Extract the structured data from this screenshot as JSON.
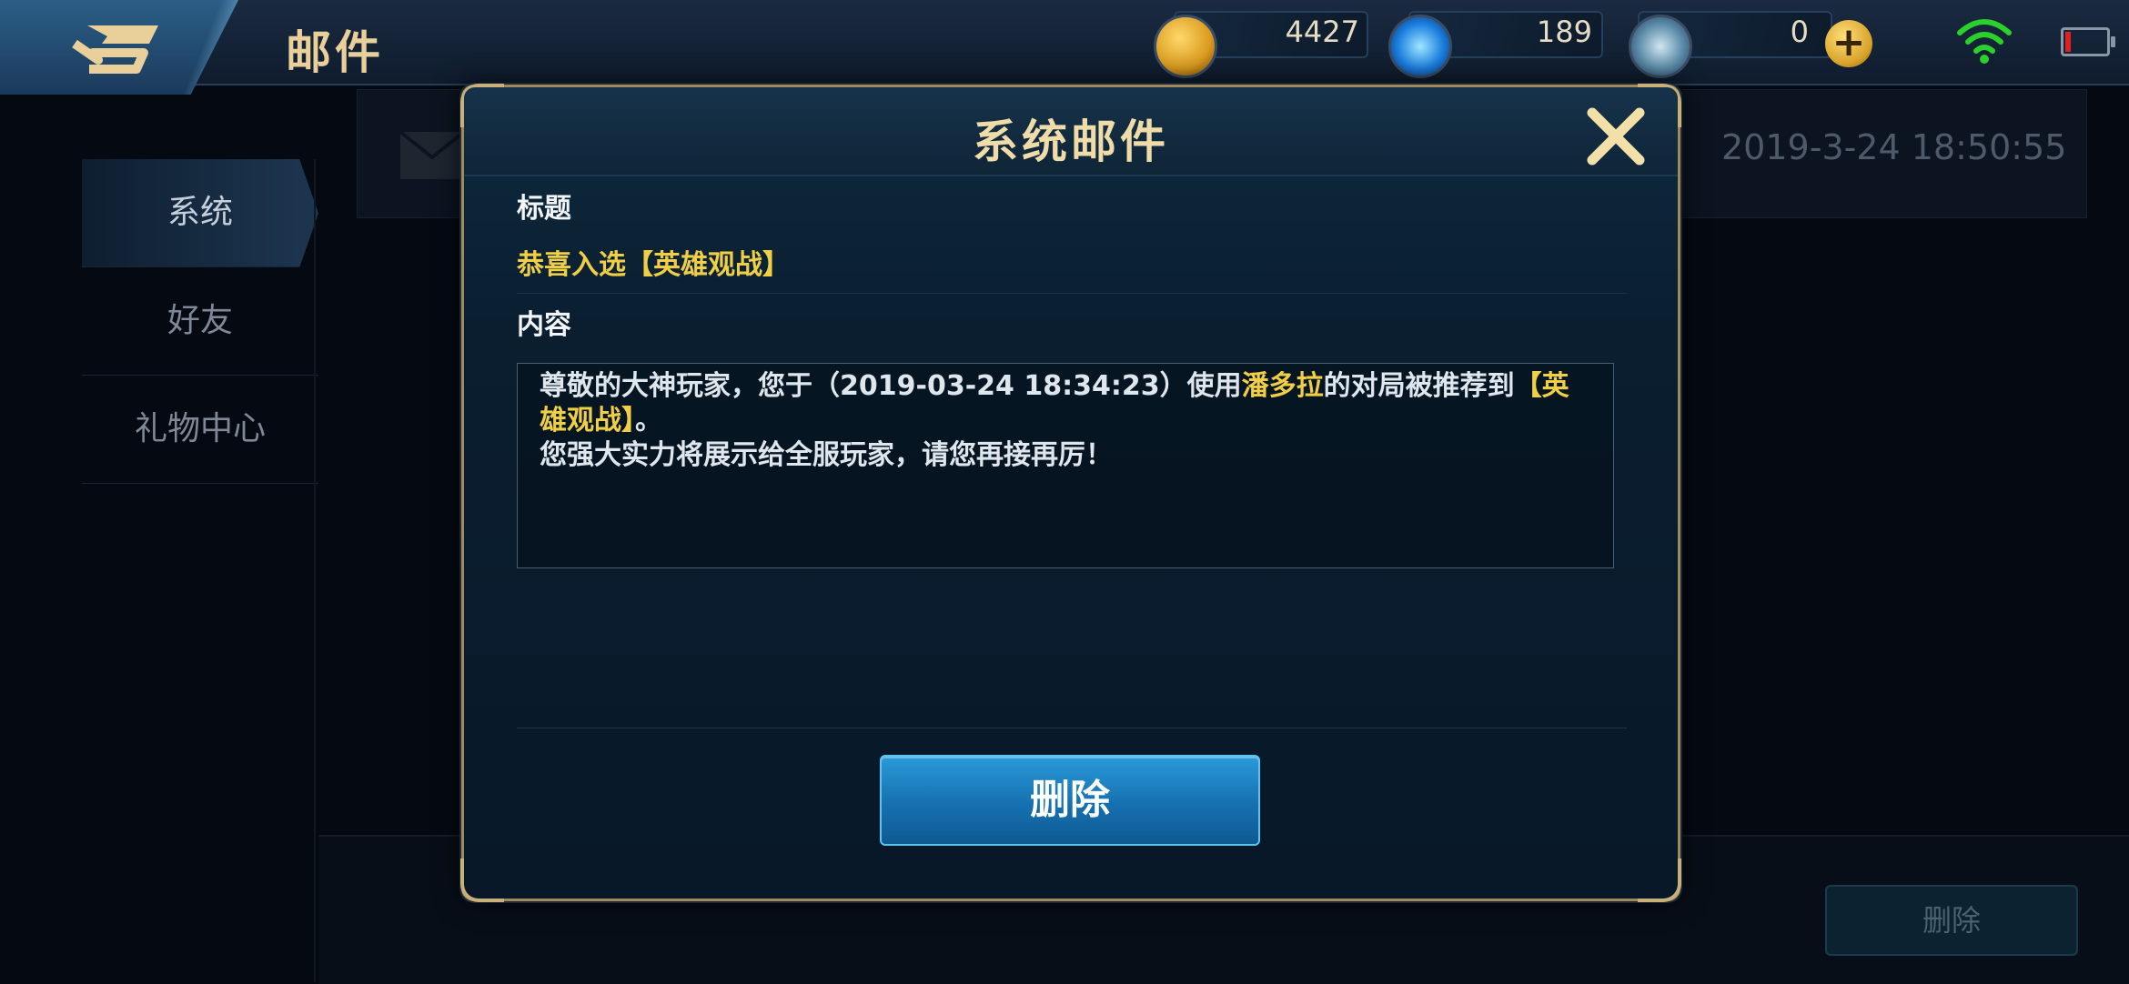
{
  "header": {
    "title": "邮件",
    "back_icon": "back-arrow-icon",
    "currencies": [
      {
        "icon": "gold-coin-icon",
        "value": "4427"
      },
      {
        "icon": "diamond-icon",
        "value": "189"
      },
      {
        "icon": "coupon-icon",
        "value": "0"
      }
    ],
    "plus_label": "+"
  },
  "sidebar": {
    "items": [
      {
        "label": "系统",
        "active": true
      },
      {
        "label": "好友",
        "active": false
      },
      {
        "label": "礼物中心",
        "active": false
      }
    ]
  },
  "mail_list": {
    "date": "2019-3-24 18:50:55",
    "delete_label": "删除"
  },
  "modal": {
    "title": "系统邮件",
    "subject_label": "标题",
    "subject": "恭喜入选【英雄观战】",
    "content_label": "内容",
    "content": {
      "part1": "尊敬的大神玩家，您于（2019-03-24 18:34:23）使用",
      "hero": "潘多拉",
      "part2": "的对局被推荐到",
      "highlight": "【英雄观战】",
      "part3": "。",
      "line2": "您强大实力将展示给全服玩家，请您再接再厉！"
    },
    "delete_label": "删除"
  },
  "colors": {
    "gold_text": "#e9cf9a",
    "highlight": "#f0cf46",
    "button_blue": "#1670b0"
  }
}
